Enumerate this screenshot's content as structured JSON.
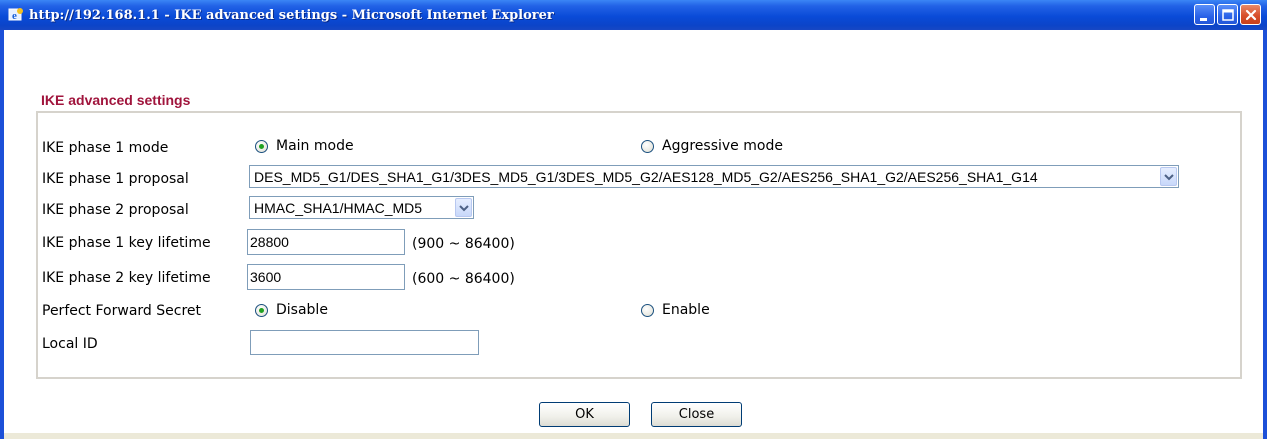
{
  "window": {
    "title": "http://192.168.1.1 - IKE advanced settings - Microsoft Internet Explorer",
    "controls": {
      "minimize": "minimize-icon",
      "maximize": "maximize-icon",
      "close": "close-icon"
    },
    "title_bar_color": "#0a4bd8"
  },
  "section_title": "IKE advanced settings",
  "fields": {
    "phase1_mode": {
      "label": "IKE phase 1 mode",
      "options": [
        "Main mode",
        "Aggressive mode"
      ],
      "selected": "Main mode"
    },
    "phase1_proposal": {
      "label": "IKE phase 1 proposal",
      "value": "DES_MD5_G1/DES_SHA1_G1/3DES_MD5_G1/3DES_MD5_G2/AES128_MD5_G2/AES256_SHA1_G2/AES256_SHA1_G14"
    },
    "phase2_proposal": {
      "label": "IKE phase 2 proposal",
      "value": "HMAC_SHA1/HMAC_MD5"
    },
    "phase1_lifetime": {
      "label": "IKE phase 1 key lifetime",
      "value": "28800",
      "range": "(900 ~ 86400)"
    },
    "phase2_lifetime": {
      "label": "IKE phase 2 key lifetime",
      "value": "3600",
      "range": "(600 ~ 86400)"
    },
    "pfs": {
      "label": "Perfect Forward Secret",
      "options": [
        "Disable",
        "Enable"
      ],
      "selected": "Disable"
    },
    "local_id": {
      "label": "Local ID",
      "value": ""
    }
  },
  "buttons": {
    "ok": "OK",
    "close": "Close"
  },
  "colors": {
    "section_title": "#a0143c",
    "radio_checked": "#21a121"
  }
}
